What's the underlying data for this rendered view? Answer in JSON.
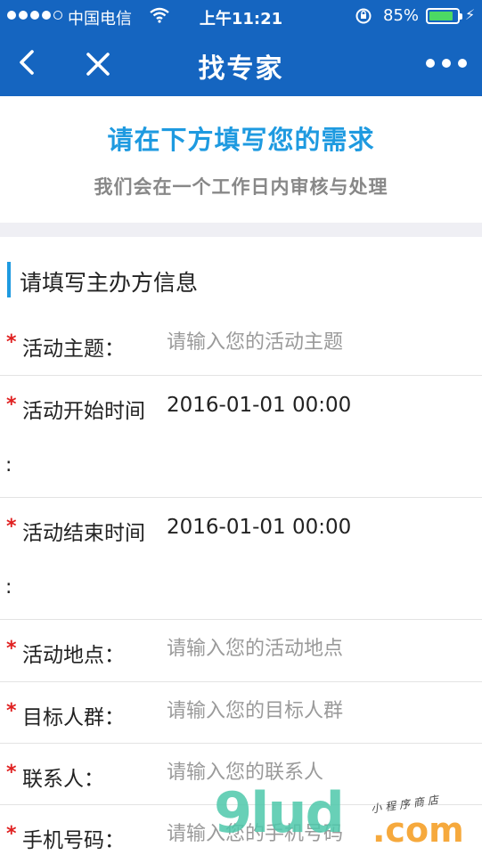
{
  "status_bar": {
    "carrier": "中国电信",
    "time": "上午11:21",
    "battery_percent": "85%",
    "battery_level": 0.85,
    "battery_color": "#4cd964"
  },
  "nav": {
    "title": "找专家",
    "back_icon": "chevron-left-icon",
    "close_icon": "close-icon",
    "more_icon": "more-horizontal-icon",
    "bar_color": "#1565c0"
  },
  "header": {
    "title": "请在下方填写您的需求",
    "subtitle": "我们会在一个工作日内审核与处理",
    "accent": "#1e9ae0"
  },
  "section": {
    "title": "请填写主办方信息"
  },
  "form": {
    "required_mark": "*",
    "topic": {
      "label": "活动主题：",
      "placeholder": "请输入您的活动主题"
    },
    "start_time": {
      "label": "活动开始时间",
      "label_tail": ":",
      "value": "2016-01-01  00:00"
    },
    "end_time": {
      "label": "活动结束时间",
      "label_tail": ":",
      "value": "2016-01-01  00:00"
    },
    "location": {
      "label": "活动地点：",
      "placeholder": "请输入您的活动地点"
    },
    "audience": {
      "label": "目标人群：",
      "placeholder": "请输入您的目标人群"
    },
    "contact": {
      "label": "联系人：",
      "placeholder": "请输入您的联系人"
    },
    "phone": {
      "label": "手机号码：",
      "placeholder": "请输入您的手机号码"
    }
  },
  "watermark": {
    "brand": "9lud",
    "domain": ".com",
    "tagline": "小程序商店"
  }
}
